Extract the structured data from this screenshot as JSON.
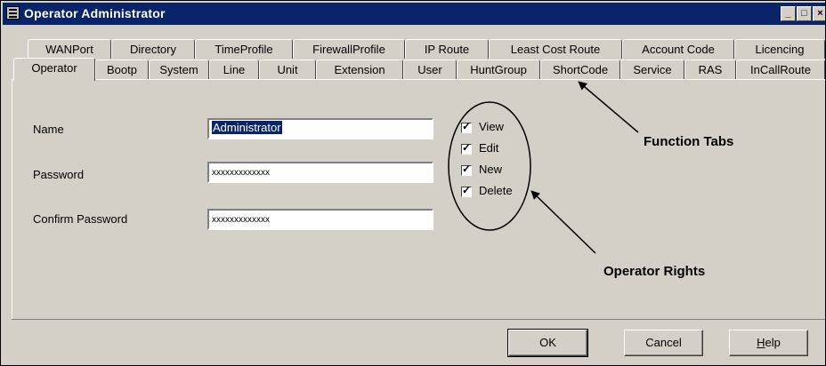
{
  "window": {
    "title": "Operator Administrator",
    "caption_buttons": {
      "minimize": "_",
      "maximize": "□",
      "close": "×"
    }
  },
  "tabs_row1": [
    "WANPort",
    "Directory",
    "TimeProfile",
    "FirewallProfile",
    "IP Route",
    "Least Cost Route",
    "Account Code",
    "Licencing"
  ],
  "tabs_row2": [
    "Operator",
    "Bootp",
    "System",
    "Line",
    "Unit",
    "Extension",
    "User",
    "HuntGroup",
    "ShortCode",
    "Service",
    "RAS",
    "InCallRoute"
  ],
  "form": {
    "name_label": "Name",
    "name_value": "Administrator",
    "password_label": "Password",
    "password_value": "xxxxxxxxxxxxx",
    "confirm_label": "Confirm Password",
    "confirm_value": "xxxxxxxxxxxxx"
  },
  "rights": [
    {
      "label": "View",
      "checked": true
    },
    {
      "label": "Edit",
      "checked": true
    },
    {
      "label": "New",
      "checked": true
    },
    {
      "label": "Delete",
      "checked": true
    }
  ],
  "annotations": {
    "function_tabs": "Function Tabs",
    "operator_rights": "Operator Rights"
  },
  "buttons": {
    "ok": "OK",
    "cancel": "Cancel",
    "help_hotkey": "H",
    "help_rest": "elp"
  }
}
